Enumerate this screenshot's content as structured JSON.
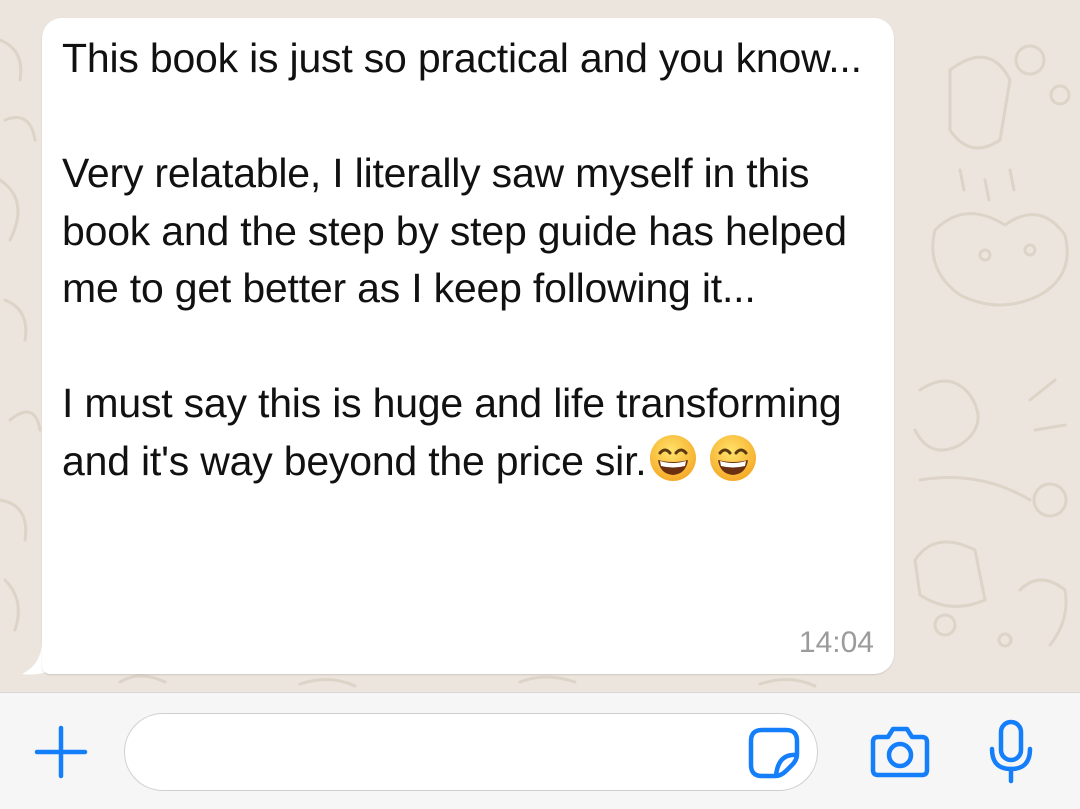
{
  "message": {
    "text": "This book is just so practical and you know...\n\nVery relatable, I literally saw myself in this book and the step by step guide has helped me to get better as I keep following it...\n\nI must say this is huge and life transforming and it's way beyond the price sir.",
    "emojis": [
      "grinning-face-with-smiling-eyes",
      "grinning-face-with-smiling-eyes"
    ],
    "timestamp": "14:04"
  },
  "composer": {
    "value": "",
    "placeholder": "",
    "icons": [
      "plus-icon",
      "sticker-icon",
      "camera-icon",
      "microphone-icon"
    ]
  },
  "colors": {
    "accent": "#147efb",
    "chat_background": "#ece5dd",
    "bubble": "#ffffff",
    "timestamp": "#9b9b9b",
    "input_bar": "#f6f6f6"
  }
}
